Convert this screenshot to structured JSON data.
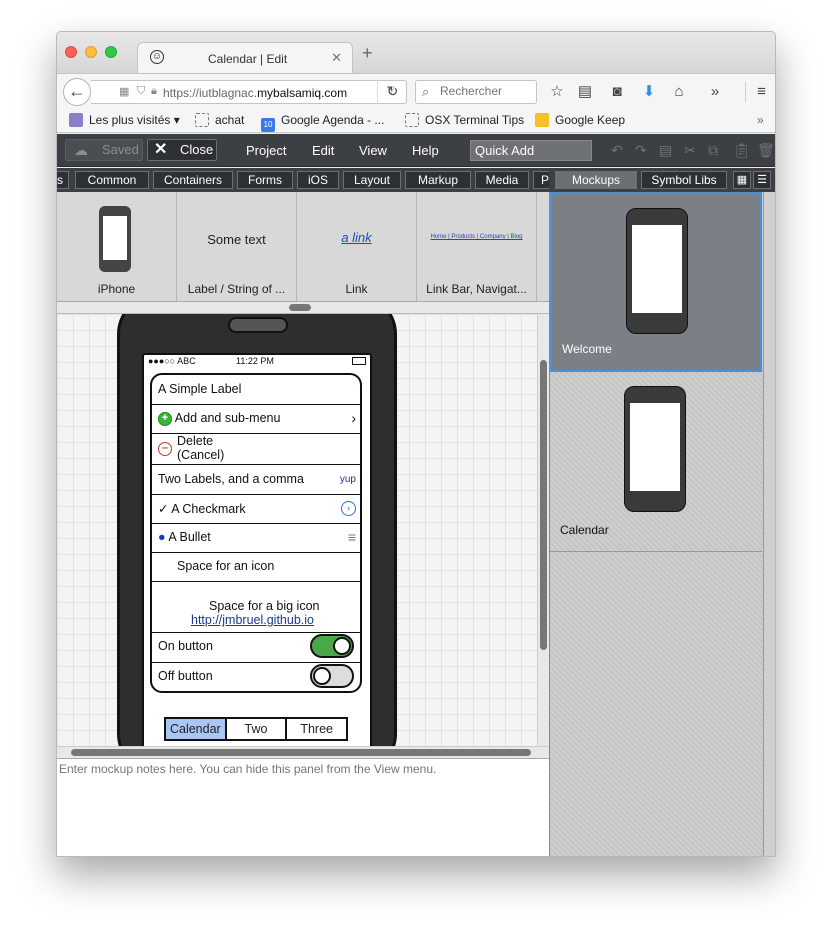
{
  "browser": {
    "tab_title": "Calendar | Edit",
    "url_prefix": "https://iutblagnac.",
    "url_domain": "mybalsamiq.com",
    "search_placeholder": "Rechercher"
  },
  "bookmarks": [
    {
      "label": "Les plus visités"
    },
    {
      "label": "achat"
    },
    {
      "label": "Google Agenda - ..."
    },
    {
      "label": "OSX Terminal Tips"
    },
    {
      "label": "Google Keep"
    }
  ],
  "toolbar": {
    "saved_label": "Saved",
    "close_label": "Close",
    "menus": [
      "Project",
      "Edit",
      "View",
      "Help"
    ],
    "quick_add_value": "Quick Add"
  },
  "library_tabs": [
    "s",
    "Common",
    "Containers",
    "Forms",
    "iOS",
    "Layout",
    "Markup",
    "Media",
    "P"
  ],
  "right_tabs": {
    "mockups": "Mockups",
    "symbols": "Symbol Libs"
  },
  "components": [
    {
      "label": "iPhone"
    },
    {
      "label": "Label / String of ...",
      "sample": "Some text"
    },
    {
      "label": "Link",
      "sample": "a link"
    },
    {
      "label": "Link Bar, Navigat...",
      "sample": "Home | Products | Company | Blog"
    }
  ],
  "mockup": {
    "status_left": "●●●○○ ABC",
    "status_time": "11:22 PM",
    "rows": {
      "simple_label": "A Simple Label",
      "add_submenu": "Add and sub-menu",
      "delete_line1": "Delete",
      "delete_line2": "(Cancel)",
      "two_labels": "Two Labels, and a comma",
      "two_labels_value": "yup",
      "checkmark": "A Checkmark",
      "bullet": "A Bullet",
      "space_icon": "Space for an icon",
      "space_big_icon": "Space for a big icon",
      "link": "http://jmbruel.github.io",
      "on_button": "On button",
      "off_button": "Off button"
    },
    "segments": [
      "Calendar",
      "Two",
      "Three"
    ]
  },
  "notes_placeholder": "Enter mockup notes here. You can hide this panel from the View menu.",
  "mockups_list": [
    {
      "name": "Welcome",
      "selected": true
    },
    {
      "name": "Calendar",
      "selected": false
    }
  ]
}
